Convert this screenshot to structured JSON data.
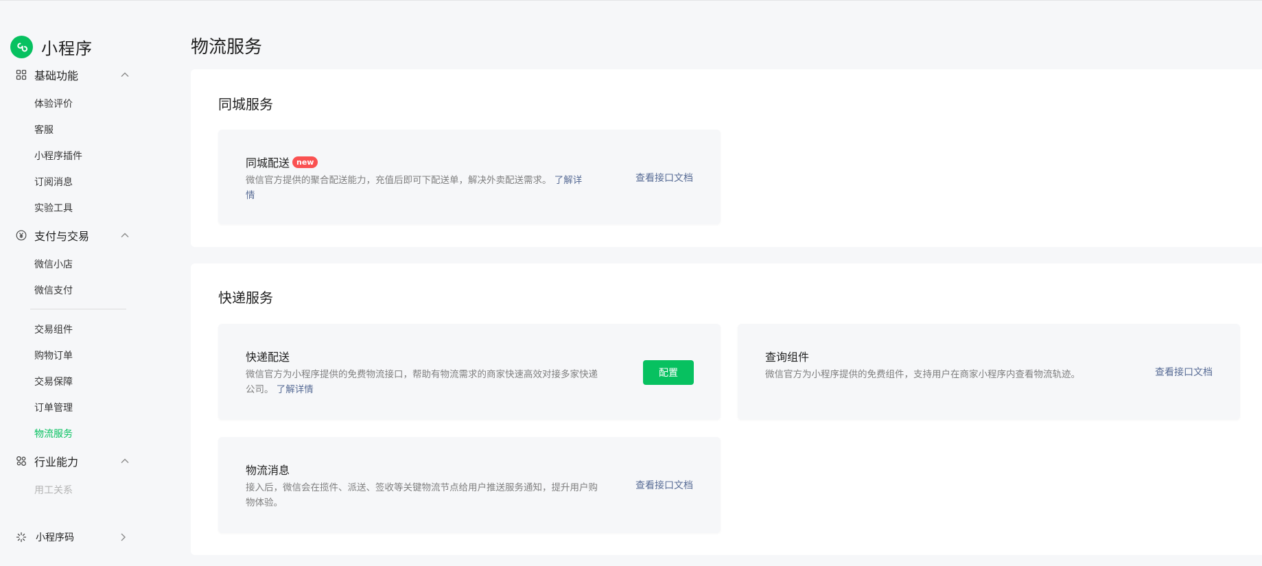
{
  "app": {
    "logo_text": "小程序",
    "brand_color": "#07c160"
  },
  "sidebar": {
    "groups": [
      {
        "label": "基础功能",
        "icon": "grid-icon",
        "expanded": true,
        "items": [
          "体验评价",
          "客服",
          "小程序插件",
          "订阅消息",
          "实验工具"
        ]
      },
      {
        "label": "支付与交易",
        "icon": "yen-icon",
        "expanded": true,
        "items": [
          "微信小店",
          "微信支付",
          "交易组件",
          "购物订单",
          "交易保障",
          "订单管理",
          "物流服务"
        ]
      },
      {
        "label": "行业能力",
        "icon": "industry-icon",
        "expanded": true,
        "items": [
          "用工关系"
        ]
      },
      {
        "label": "小程序码",
        "icon": "qrcode-icon",
        "expanded": false,
        "items": []
      }
    ],
    "active_item": "物流服务"
  },
  "page": {
    "title": "物流服务"
  },
  "city_service": {
    "title": "同城服务",
    "delivery": {
      "title": "同城配送",
      "badge": "new",
      "desc": "微信官方提供的聚合配送能力，充值后即可下配送单，解决外卖配送需求。",
      "desc_link": "了解详情",
      "doc_link": "查看接口文档"
    }
  },
  "express_service": {
    "title": "快递服务",
    "express_delivery": {
      "title": "快递配送",
      "desc": "微信官方为小程序提供的免费物流接口，帮助有物流需求的商家快速高效对接多家快递公司。",
      "desc_link": "了解详情",
      "button": "配置"
    },
    "query_component": {
      "title": "查询组件",
      "desc": "微信官方为小程序提供的免费组件，支持用户在商家小程序内查看物流轨迹。",
      "doc_link": "查看接口文档"
    },
    "logistics_message": {
      "title": "物流消息",
      "desc": "接入后，微信会在揽件、派送、签收等关键物流节点给用户推送服务通知，提升用户购物体验。",
      "doc_link": "查看接口文档"
    }
  }
}
